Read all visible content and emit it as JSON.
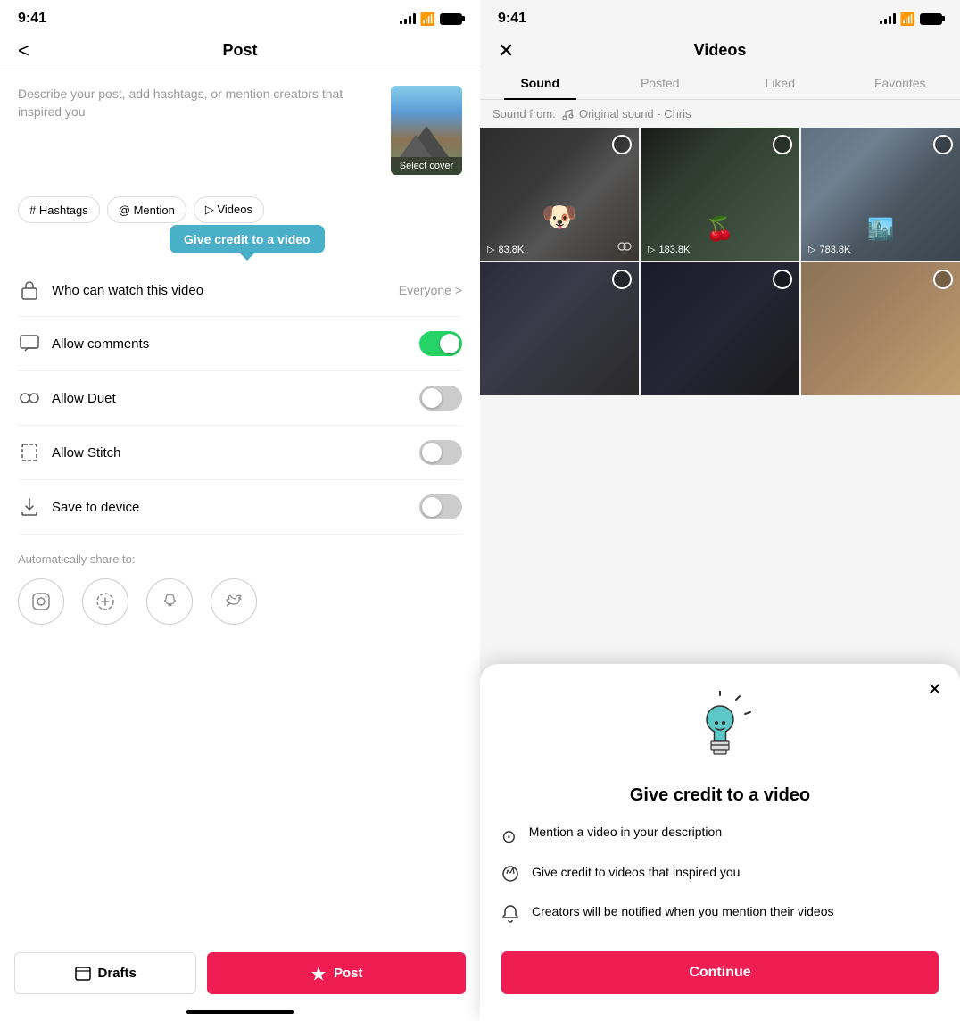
{
  "left": {
    "status_time": "9:41",
    "header_title": "Post",
    "back_label": "<",
    "description_placeholder": "Describe your post, add hashtags, or mention creators that inspired you",
    "cover_label": "Select cover",
    "hashtags_btn": "# Hashtags",
    "mention_btn": "@ Mention",
    "videos_btn": "▷ Videos",
    "tooltip_text": "Give credit to a video",
    "settings": [
      {
        "id": "who-can-watch",
        "label": "Who can watch this video",
        "value": "Everyone",
        "type": "nav"
      },
      {
        "id": "allow-comments",
        "label": "Allow comments",
        "type": "toggle",
        "on": true
      },
      {
        "id": "allow-duet",
        "label": "Allow Duet",
        "type": "toggle",
        "on": false
      },
      {
        "id": "allow-stitch",
        "label": "Allow Stitch",
        "type": "toggle",
        "on": false
      },
      {
        "id": "save-to-device",
        "label": "Save to device",
        "type": "toggle",
        "on": false
      }
    ],
    "share_label": "Automatically share to:",
    "drafts_label": "Drafts",
    "post_label": "Post"
  },
  "right": {
    "status_time": "9:41",
    "close_label": "✕",
    "header_title": "Videos",
    "tabs": [
      {
        "id": "sound",
        "label": "Sound",
        "active": true
      },
      {
        "id": "posted",
        "label": "Posted",
        "active": false
      },
      {
        "id": "liked",
        "label": "Liked",
        "active": false
      },
      {
        "id": "favorites",
        "label": "Favorites",
        "active": false
      }
    ],
    "sound_from_label": "Sound from:",
    "sound_name": "Original sound - Chris",
    "videos": [
      {
        "id": 1,
        "stats": "83.8K",
        "has_collab": true
      },
      {
        "id": 2,
        "stats": "183.8K",
        "has_collab": false
      },
      {
        "id": 3,
        "stats": "783.8K",
        "has_collab": false
      }
    ]
  },
  "modal": {
    "title": "Give credit to a video",
    "close_label": "✕",
    "items": [
      {
        "icon": "@",
        "text": "Mention a video in your description"
      },
      {
        "icon": "💡",
        "text": "Give credit to videos that inspired you"
      },
      {
        "icon": "🔔",
        "text": "Creators will be notified when you mention their videos"
      }
    ],
    "continue_label": "Continue"
  }
}
